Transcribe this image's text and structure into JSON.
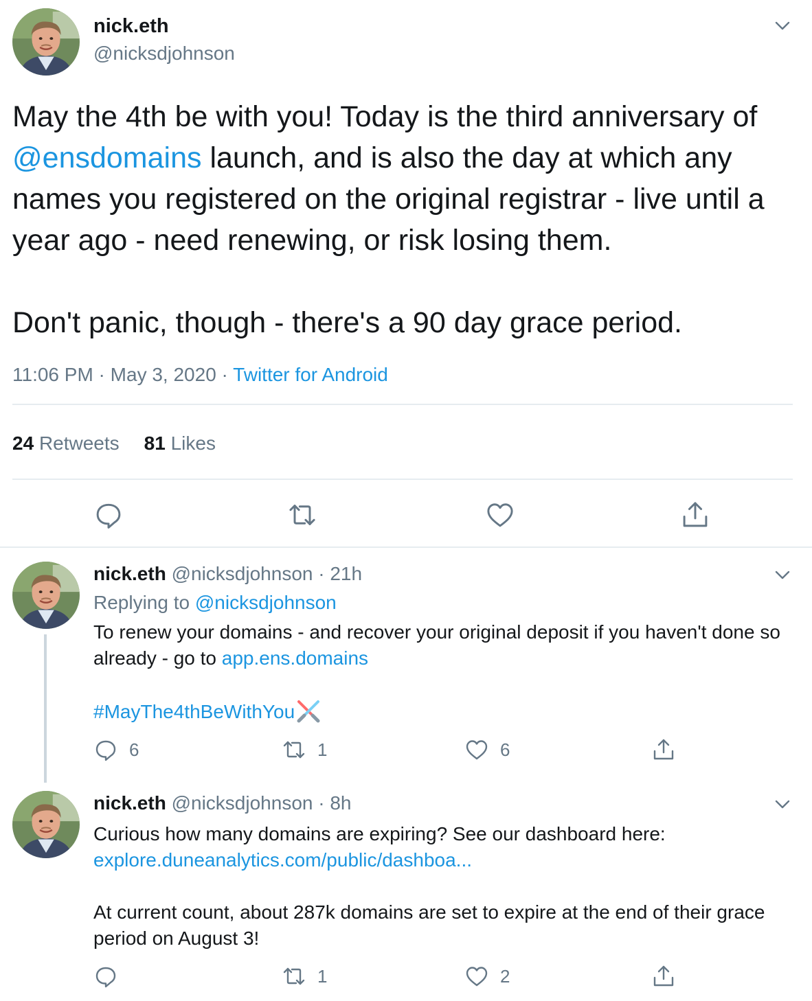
{
  "main": {
    "name": "nick.eth",
    "handle": "@nicksdjohnson",
    "text_pre": "May the 4th be with you! Today is the third anniversary of ",
    "mention": "@ensdomains",
    "text_post": " launch, and is also the day at which any names you registered on the original registrar - live until a year ago - need renewing, or risk losing them.\n\nDon't panic, though - there's a 90 day grace period.",
    "time": "11:06 PM",
    "sep": " · ",
    "date": "May 3, 2020",
    "source": "Twitter for Android",
    "retweets_count": "24",
    "retweets_label": "Retweets",
    "likes_count": "81",
    "likes_label": "Likes"
  },
  "replies": [
    {
      "name": "nick.eth",
      "handle": "@nicksdjohnson",
      "dot": " · ",
      "age": "21h",
      "replying_prefix": "Replying to ",
      "replying_to": "@nicksdjohnson",
      "text": "To renew your domains - and recover your original deposit if you haven't done so already - go to ",
      "link": "app.ens.domains",
      "hashtag": "#MayThe4thBeWithYou",
      "reply_count": "6",
      "retweet_count": "1",
      "like_count": "6"
    },
    {
      "name": "nick.eth",
      "handle": "@nicksdjohnson",
      "dot": " · ",
      "age": "8h",
      "text": "Curious how many domains are expiring? See our dashboard here:",
      "link": "explore.duneanalytics.com/public/dashboa...",
      "text2": "At current count, about 287k domains are set to expire at the end of their grace period on August 3!",
      "reply_count": "",
      "retweet_count": "1",
      "like_count": "2"
    }
  ],
  "colors": {
    "link": "#1b95e0",
    "muted": "#657786",
    "icon": "#657786",
    "divider": "#e6ecf0"
  },
  "icons": [
    "chevron-down-icon",
    "reply-icon",
    "retweet-icon",
    "like-icon",
    "share-icon",
    "lightsaber-emoji"
  ]
}
